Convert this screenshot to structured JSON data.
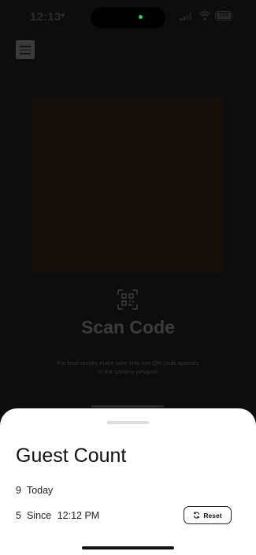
{
  "status_bar": {
    "time": "12:13",
    "battery": "100"
  },
  "scanner": {
    "title": "Scan Code",
    "hint": "For best results make sure only one QR code appears in the camera viewport"
  },
  "sheet": {
    "title": "Guest Count",
    "today": {
      "count": "9",
      "label": "Today"
    },
    "since": {
      "count": "5",
      "label": "Since",
      "time": "12:12 PM"
    },
    "reset_label": "Reset"
  },
  "icons": {
    "menu": "hamburger-menu-icon",
    "qr": "qr-code-icon",
    "reset": "refresh-icon"
  }
}
